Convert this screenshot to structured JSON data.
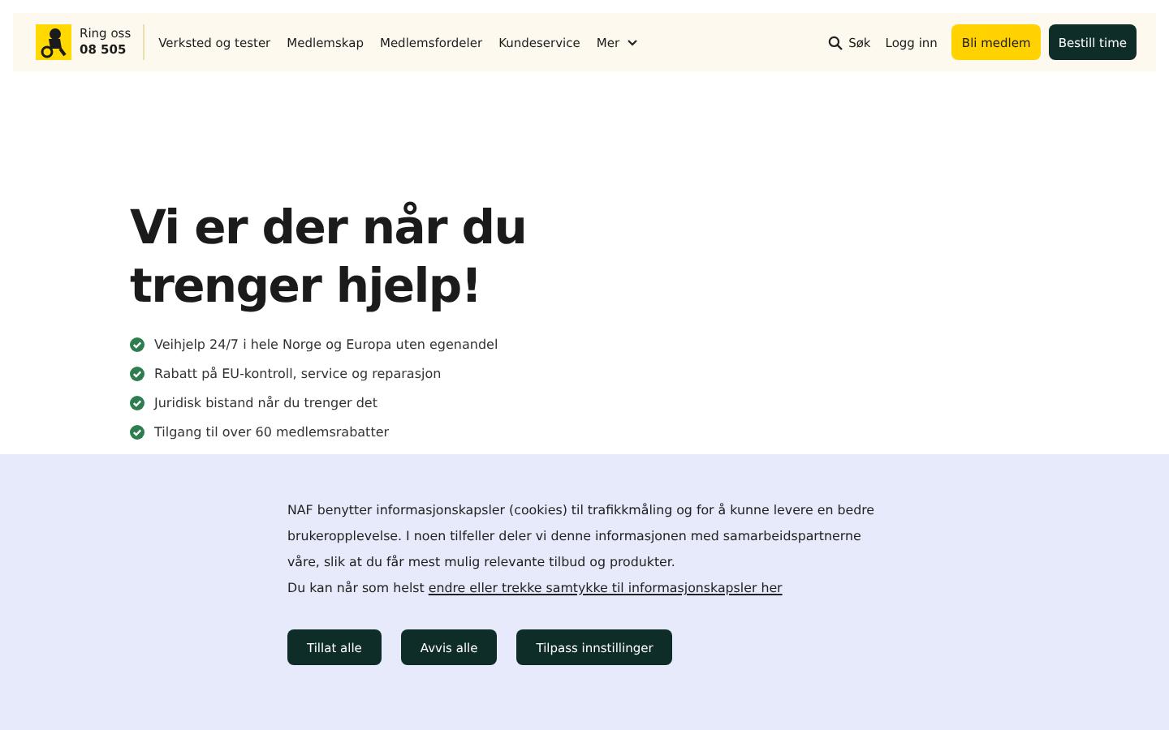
{
  "header": {
    "phone_label": "Ring oss",
    "phone_number": "08 505",
    "nav": [
      "Verksted og tester",
      "Medlemskap",
      "Medlemsfordeler",
      "Kundeservice"
    ],
    "more": "Mer",
    "search": "Søk",
    "login": "Logg inn",
    "join": "Bli medlem",
    "book": "Bestill time"
  },
  "hero": {
    "title": "Vi er der når du trenger hjelp!",
    "benefits": [
      "Veihjelp 24/7 i hele Norge og Europa uten egenandel",
      "Rabatt på EU-kontroll, service og reparasjon",
      "Juridisk bistand når du trenger det",
      "Tilgang til over 60 medlemsrabatter"
    ]
  },
  "cookie_banner": {
    "text": "NAF benytter informasjonskapsler (cookies) til trafikkmåling og for å kunne levere en bedre brukeropplevelse. I noen tilfeller deler vi denne informasjonen med samarbeidspartnerne våre, slik at du får mest mulig relevante tilbud og produkter.",
    "consent_text": "Du kan når som helst",
    "consent_link": "endre eller trekke samtykke til informasjonskapsler her",
    "buttons": [
      "Tillat alle",
      "Avvis alle",
      "Tilpass innstillinger"
    ]
  }
}
